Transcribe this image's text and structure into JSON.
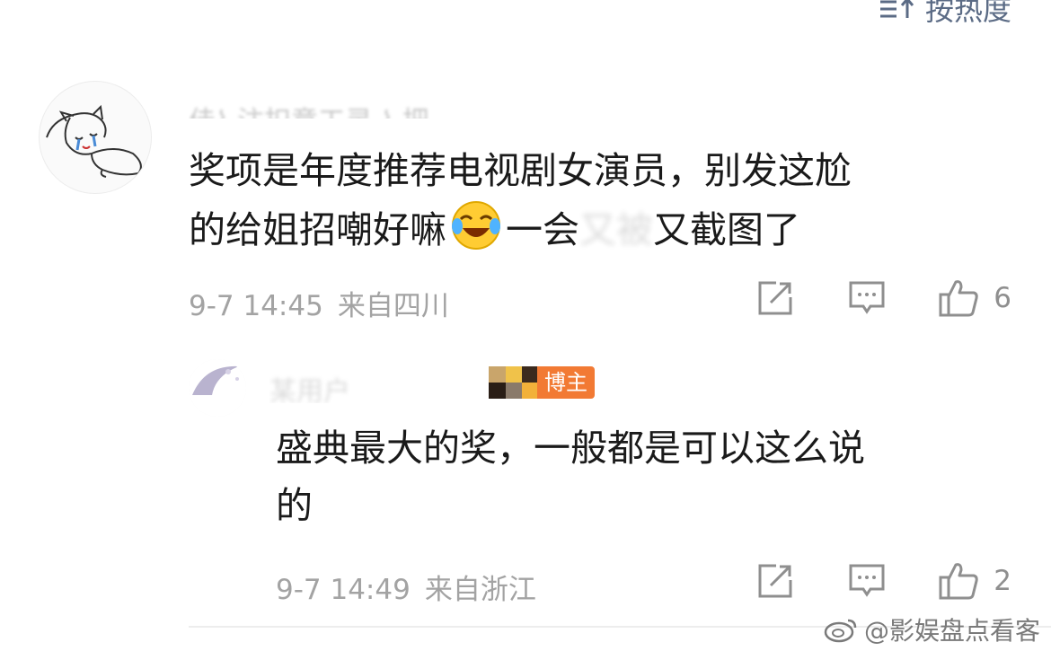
{
  "sort": {
    "label": "按热度"
  },
  "comments": [
    {
      "username": "佳⌇ 注扣意工灵 ⌇ 把",
      "lines": [
        "奖项是年度推荐电视剧女演员，别发这尬",
        "的给姐招嘲好嘛",
        "一会",
        "又截图了"
      ],
      "redacted": "又被",
      "emoji": "laugh-crying-emoji",
      "time": "9-7 14:45",
      "location": "来自四川",
      "likes": "6"
    },
    {
      "username": "某用户",
      "badge": "博主",
      "lines": [
        "盛典最大的奖，一般都是可以这么说",
        "的"
      ],
      "time": "9-7 14:49",
      "location": "来自浙江",
      "likes": "2"
    }
  ],
  "watermark": "@影娱盘点看客",
  "colors": {
    "badge": "#f27a34",
    "sort": "#5b6b85",
    "meta": "#a3a3a3"
  }
}
